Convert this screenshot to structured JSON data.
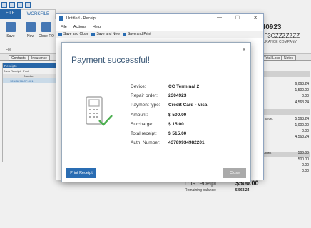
{
  "ribbon": {
    "tabs": [
      "FILE",
      "WORKFILE"
    ],
    "buttons": [
      "Save",
      "New",
      "Close RO"
    ],
    "group_file": "File"
  },
  "header": {
    "title": "O 2340923",
    "sub1": "A6P8CF3GZZZZZZZ",
    "sub2": "ALITY INSURANCE COMPANY"
  },
  "doc_tabs": [
    "Contacts",
    "Insurance",
    "Total Loss",
    "Notes"
  ],
  "receipts_panel": {
    "title": "Receipts",
    "new_receipt": "New Receipt",
    "print": "Print",
    "column": "Number",
    "row": "12345678-CF-001"
  },
  "right_panel": {
    "rows": [
      {
        "label": "Total:",
        "value": "6,063.24"
      },
      {
        "label": "id:",
        "value": "1,500.00"
      },
      {
        "label": "ments:",
        "value": "0.00"
      },
      {
        "label": "e Due:",
        "value": "4,563.24"
      },
      {
        "label": "wn Insurance:",
        "value": "5,563.24"
      },
      {
        "label": "id:",
        "value": "1,000.00"
      },
      {
        "label": "ments:",
        "value": "0.00"
      },
      {
        "label": "e Due:",
        "value": "4,563.24"
      },
      {
        "label": "sh Customer:",
        "value": "500.00"
      },
      {
        "label": "id:",
        "value": "500.00"
      },
      {
        "label": "ments:",
        "value": "0.00"
      },
      {
        "label": "e Due:",
        "value": "0.00"
      }
    ],
    "this_receipt_label": "This receipt:",
    "this_receipt_value": "$500.00",
    "remaining_label": "Remaining balance:",
    "remaining_value": "5,563.24"
  },
  "receipt_window": {
    "title": "Untitled - Receipt",
    "menu": [
      "File",
      "Actions",
      "Help"
    ],
    "toolbar": [
      "Save and Close",
      "Save and New",
      "Save and Print"
    ]
  },
  "dialog": {
    "title": "Payment successful!",
    "fields": [
      {
        "label": "Device:",
        "value": "CC Terminal 2"
      },
      {
        "label": "Repair order:",
        "value": "2304923"
      },
      {
        "label": "Payment type:",
        "value": "Credit Card - Visa"
      },
      {
        "label": "Amount:",
        "value": "$ 500.00"
      },
      {
        "label": "Surcharge:",
        "value": "$ 15.00"
      },
      {
        "label": "Total receipt:",
        "value": "$ 515.00"
      },
      {
        "label": "Auth. Number:",
        "value": "43789934982201"
      }
    ],
    "print_label": "Print Receipt",
    "close_label": "Close"
  },
  "colors": {
    "accent": "#2a6db3",
    "success": "#4caf50"
  }
}
